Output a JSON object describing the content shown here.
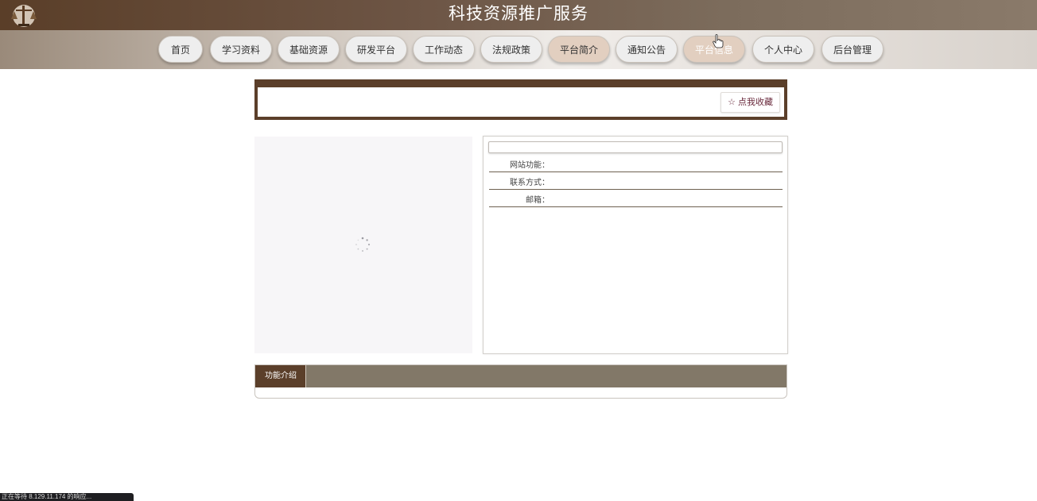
{
  "header": {
    "title": "科技资源推广服务",
    "logo_icon": "gavel-scales-logo-icon"
  },
  "nav": {
    "items": [
      {
        "label": "首页"
      },
      {
        "label": "学习资料"
      },
      {
        "label": "基础资源"
      },
      {
        "label": "研发平台"
      },
      {
        "label": "工作动态"
      },
      {
        "label": "法规政策"
      },
      {
        "label": "平台简介",
        "state": "active"
      },
      {
        "label": "通知公告"
      },
      {
        "label": "平台信息",
        "state": "hover"
      },
      {
        "label": "个人中心"
      },
      {
        "label": "后台管理"
      }
    ]
  },
  "favorite": {
    "label": "☆ 点我收藏"
  },
  "info": {
    "title": "",
    "rows": [
      {
        "label": "网站功能：",
        "value": ""
      },
      {
        "label": "联系方式：",
        "value": ""
      },
      {
        "label": "邮箱：",
        "value": ""
      }
    ]
  },
  "tabs": {
    "active_label": "功能介绍"
  },
  "status_bar": {
    "text": "正在等待 8.129.11.174 的响应..."
  },
  "colors": {
    "brand_dark": "#5b3f2a",
    "tab_bar": "#827868",
    "nav_active": "#e2cfc0"
  }
}
